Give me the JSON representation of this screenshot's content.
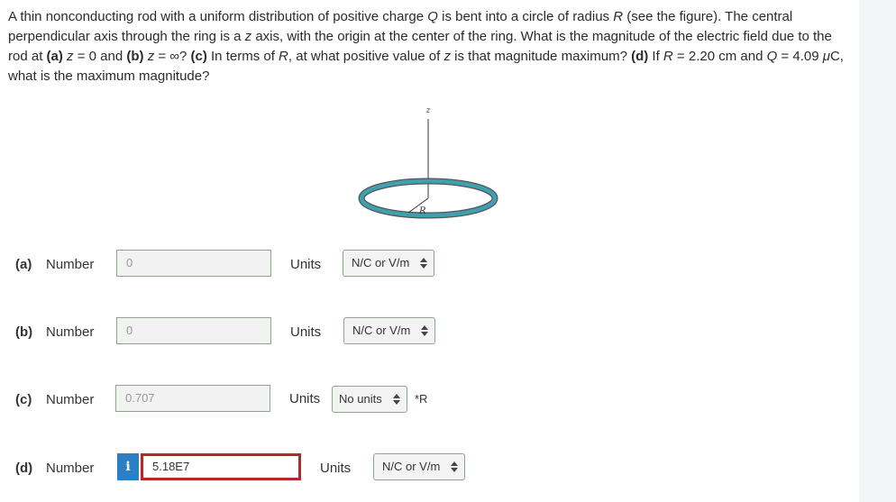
{
  "question": {
    "p1": "A thin nonconducting rod with a uniform distribution of positive charge ",
    "Q1": "Q",
    "p2": " is bent into a circle of radius ",
    "R1": "R",
    "p3": " (see the figure). The central perpendicular axis through the ring is a ",
    "z1": "z",
    "p4": " axis, with the origin at the center of the ring. What is the magnitude of the electric field due to the rod at ",
    "a": "(a)",
    "z2": "z",
    "p5": " = 0 and ",
    "b": "(b)",
    "z3": "z",
    "p6": " = ∞? ",
    "c": "(c)",
    "p7": " In terms of ",
    "R2": "R",
    "p8": ", at what positive value of ",
    "z4": "z",
    "p9": " is that magnitude maximum? ",
    "d": "(d)",
    "p10": " If ",
    "R3": "R",
    "p11": " = 2.20 cm and ",
    "Q2": "Q",
    "p12": " = 4.09 ",
    "mu": "μ",
    "p13": "C, what is the maximum magnitude?"
  },
  "figure": {
    "axis_label": "z",
    "radius_label": "R",
    "ring_color": "#3fa0b0"
  },
  "parts": [
    {
      "label": "(a)",
      "number_label": "Number",
      "value": "0",
      "units_label": "Units",
      "unit": "N/C or V/m"
    },
    {
      "label": "(b)",
      "number_label": "Number",
      "value": "0",
      "units_label": "Units",
      "unit": "N/C or V/m"
    },
    {
      "label": "(c)",
      "number_label": "Number",
      "value": "0.707",
      "units_label": "Units",
      "unit": "No units",
      "suffix": "*R"
    },
    {
      "label": "(d)",
      "number_label": "Number",
      "value": "5.18E7",
      "units_label": "Units",
      "unit": "N/C or V/m",
      "info": "i"
    }
  ]
}
